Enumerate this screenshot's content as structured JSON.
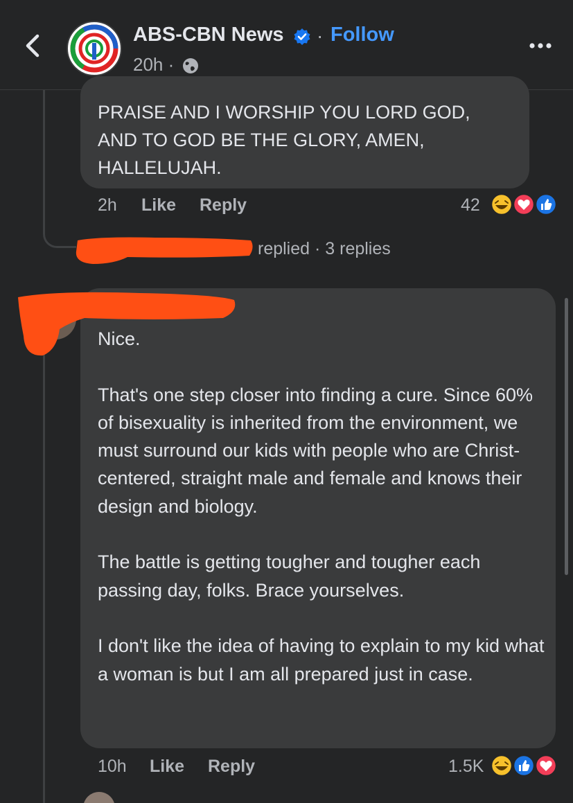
{
  "header": {
    "page_name": "ABS-CBN News",
    "separator": "·",
    "follow_label": "Follow",
    "time": "20h ·",
    "colors": {
      "follow": "#4599ff",
      "verified": "#1877f2"
    }
  },
  "comment1": {
    "text_lines": [
      "PRAISE AND I WORSHIP YOU LORD GOD,",
      "AND TO GOD BE THE GLORY, AMEN,",
      "HALLELUJAH."
    ],
    "time": "2h",
    "like_label": "Like",
    "reply_label": "Reply",
    "reaction_count": "42",
    "reactions": [
      "haha-icon",
      "love-icon",
      "like-icon"
    ]
  },
  "replies_summary": {
    "text": "replied · 3 replies"
  },
  "comment2": {
    "text": "Nice.\n\nThat's one step closer into finding a cure. Since 60% of bisexuality is inherited from the environment, we must surround our kids with people who are Christ-centered, straight male and female and knows their design and biology.\n\nThe battle is getting tougher and tougher each passing day, folks. Brace yourselves.\n\nI don't like the idea of having to explain to my kid what a woman is but I am all prepared just in case.",
    "time": "10h",
    "like_label": "Like",
    "reply_label": "Reply",
    "reaction_count": "1.5K",
    "reactions": [
      "haha-icon",
      "like-icon",
      "love-icon"
    ]
  },
  "redaction_color": "#ff4f14"
}
